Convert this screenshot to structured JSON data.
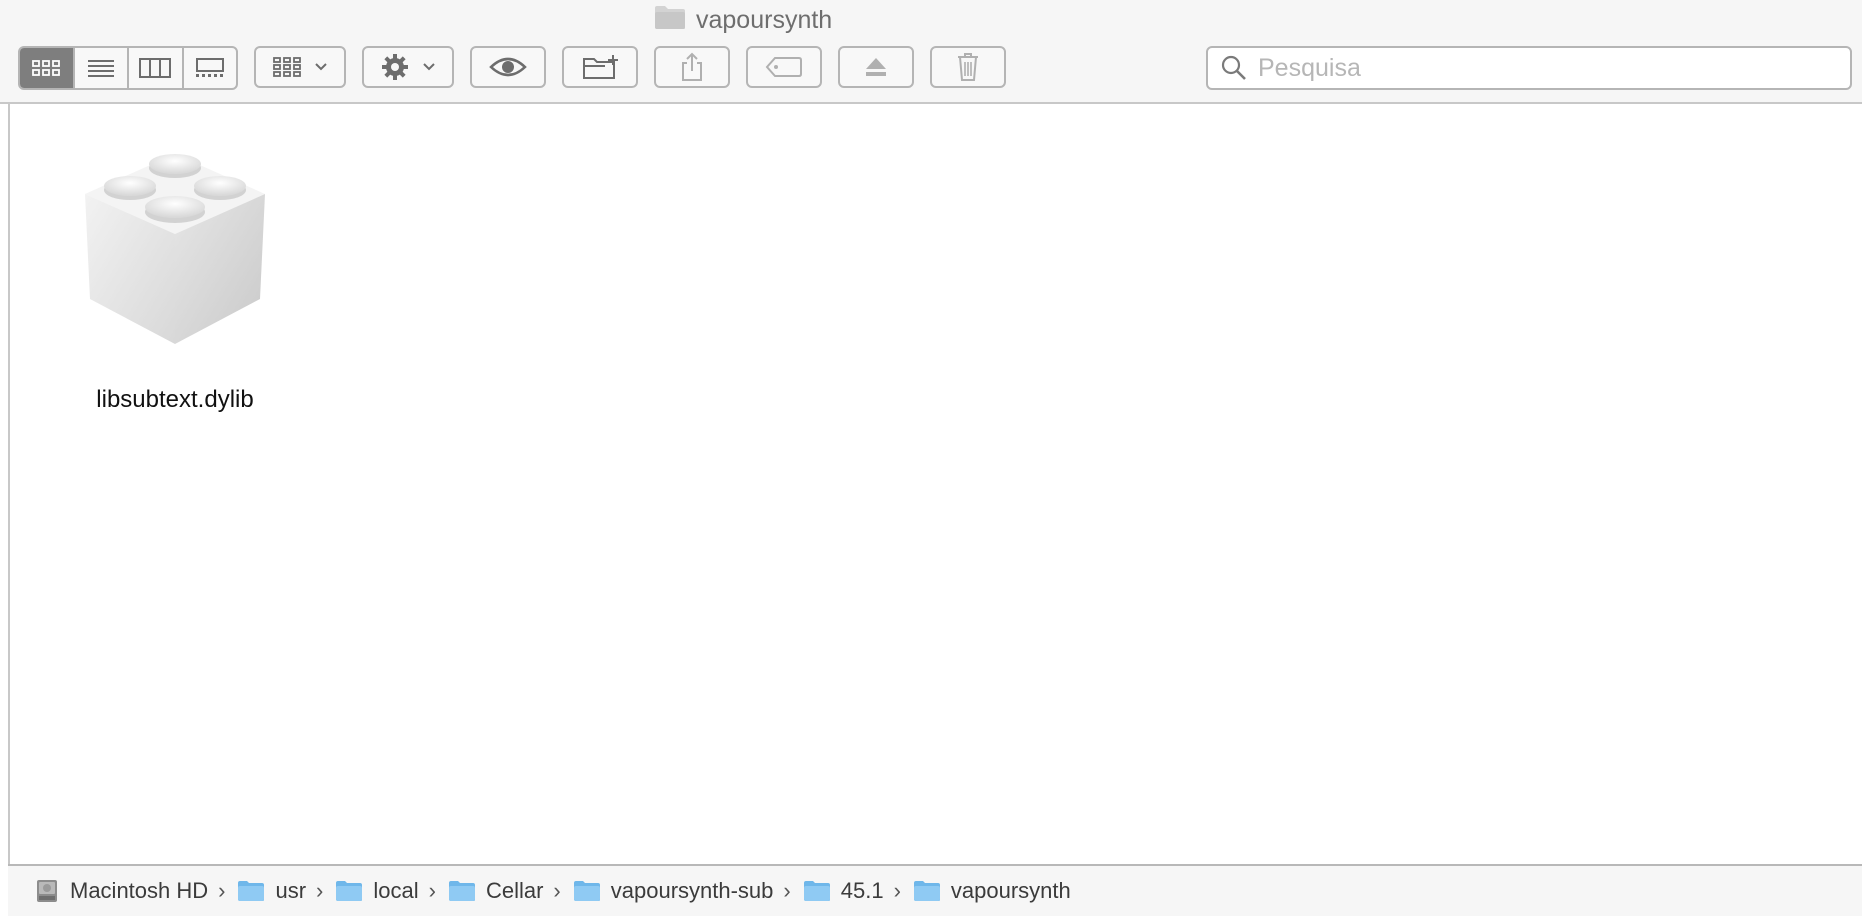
{
  "window": {
    "title": "vapoursynth"
  },
  "toolbar": {
    "view_modes": [
      "icon-view",
      "list-view",
      "column-view",
      "gallery-view"
    ],
    "active_view": "icon-view",
    "buttons": [
      "group-by",
      "action-gear",
      "quick-look",
      "new-folder",
      "share",
      "tags",
      "eject",
      "trash"
    ]
  },
  "search": {
    "placeholder": "Pesquisa",
    "value": ""
  },
  "files": [
    {
      "name": "libsubtext.dylib",
      "icon": "dylib-icon"
    }
  ],
  "pathbar": [
    {
      "label": "Macintosh HD",
      "icon": "hard-drive-icon"
    },
    {
      "label": "usr",
      "icon": "folder-icon"
    },
    {
      "label": "local",
      "icon": "folder-icon"
    },
    {
      "label": "Cellar",
      "icon": "folder-icon"
    },
    {
      "label": "vapoursynth-sub",
      "icon": "folder-icon"
    },
    {
      "label": "45.1",
      "icon": "folder-icon"
    },
    {
      "label": "vapoursynth",
      "icon": "folder-icon"
    }
  ],
  "colors": {
    "toolbar_bg": "#f6f6f6",
    "folder_blue": "#7cc3f2",
    "active_segment": "#7e7e7e"
  }
}
